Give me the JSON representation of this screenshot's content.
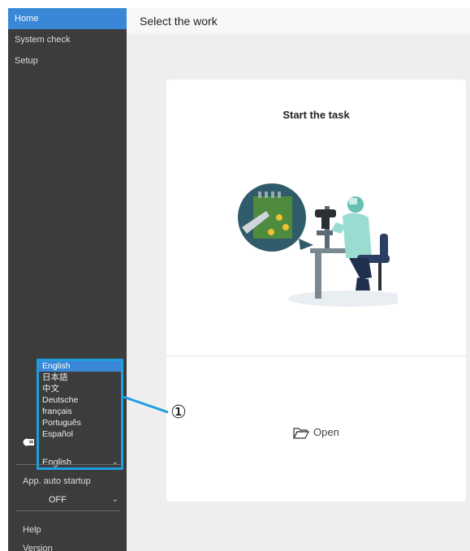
{
  "sidebar": {
    "items": [
      {
        "label": "Home",
        "active": true
      },
      {
        "label": "System check",
        "active": false
      },
      {
        "label": "Setup",
        "active": false
      }
    ],
    "language_options": [
      "English",
      "日本語",
      "中文",
      "Deutsche",
      "français",
      "Português",
      "Español"
    ],
    "language_selected": "English",
    "auto_startup_label": "App. auto startup",
    "auto_startup_value": "OFF",
    "help_label": "Help",
    "version_label": "Version"
  },
  "header": {
    "title": "Select the work"
  },
  "card": {
    "title": "Start the task",
    "open_label": "Open"
  },
  "callout": {
    "number": "①"
  },
  "colors": {
    "accent": "#3a87d8",
    "highlight": "#1e9fe0",
    "sidebar": "#3c3c3c"
  }
}
